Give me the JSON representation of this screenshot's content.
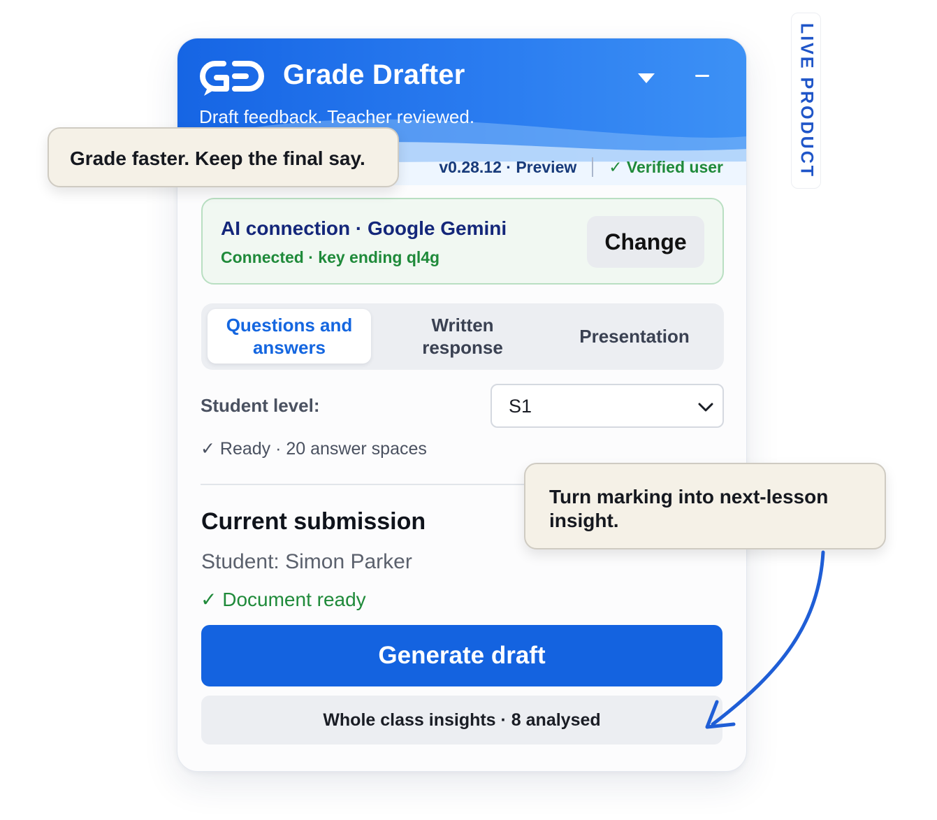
{
  "app": {
    "title": "Grade Drafter",
    "subtitle": "Draft feedback. Teacher reviewed.",
    "version": "v0.28.12 · Preview",
    "verified": "✓ Verified user"
  },
  "ai_connection": {
    "title": "AI connection · Google Gemini",
    "status": "Connected · key ending ql4g",
    "change_label": "Change"
  },
  "tabs": [
    {
      "label": "Questions and answers",
      "active": true
    },
    {
      "label": "Written response",
      "active": false
    },
    {
      "label": "Presentation",
      "active": false
    }
  ],
  "student_level": {
    "label": "Student level:",
    "value": "S1",
    "ready": "✓ Ready · 20 answer spaces"
  },
  "submission": {
    "heading": "Current submission",
    "student": "Student: Simon Parker",
    "status": "✓ Document ready"
  },
  "actions": {
    "generate": "Generate draft",
    "insights": "Whole class insights · 8 analysed"
  },
  "callouts": {
    "top": "Grade faster. Keep the final say.",
    "bottom": "Turn marking into next-lesson insight."
  },
  "tag": "LIVE PRODUCT",
  "colors": {
    "brand_blue": "#1463e0",
    "success_green": "#1f8a3a",
    "callout_bg": "#f5f1e7"
  },
  "icons": {
    "logo": "gd-logo",
    "dropdown": "caret-down-icon",
    "minimize": "minimize-icon",
    "select_chevron": "chevron-down-icon"
  }
}
